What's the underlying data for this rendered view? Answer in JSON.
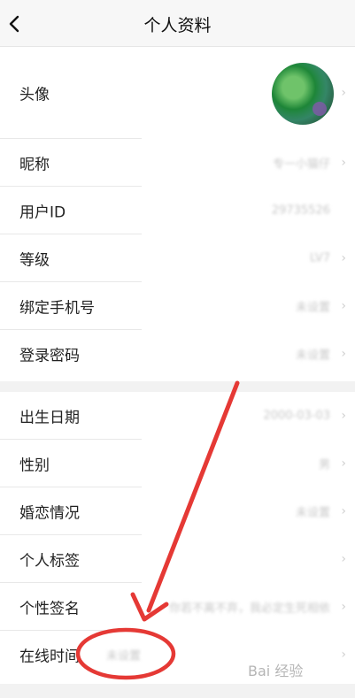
{
  "header": {
    "title": "个人资料"
  },
  "group1": {
    "rows": [
      {
        "label": "头像",
        "value": ""
      },
      {
        "label": "昵称",
        "value": "专一小猫仔"
      },
      {
        "label": "用户ID",
        "value": "29735526"
      },
      {
        "label": "等级",
        "value": "LV7"
      },
      {
        "label": "绑定手机号",
        "value": "未设置"
      },
      {
        "label": "登录密码",
        "value": "未设置"
      }
    ]
  },
  "group2": {
    "rows": [
      {
        "label": "出生日期",
        "value": "2000-03-03"
      },
      {
        "label": "性别",
        "value": "男"
      },
      {
        "label": "婚恋情况",
        "value": "未设置"
      },
      {
        "label": "个人标签",
        "value": ""
      },
      {
        "label": "个性签名",
        "value": "你若不离不弃，我必定生死相依"
      },
      {
        "label": "在线时间",
        "value": "未设置"
      }
    ]
  },
  "watermark": "Bai 经验",
  "colors": {
    "annotation": "#e53935",
    "background": "#f2f2f2",
    "value_gray": "#c8c8c8"
  }
}
